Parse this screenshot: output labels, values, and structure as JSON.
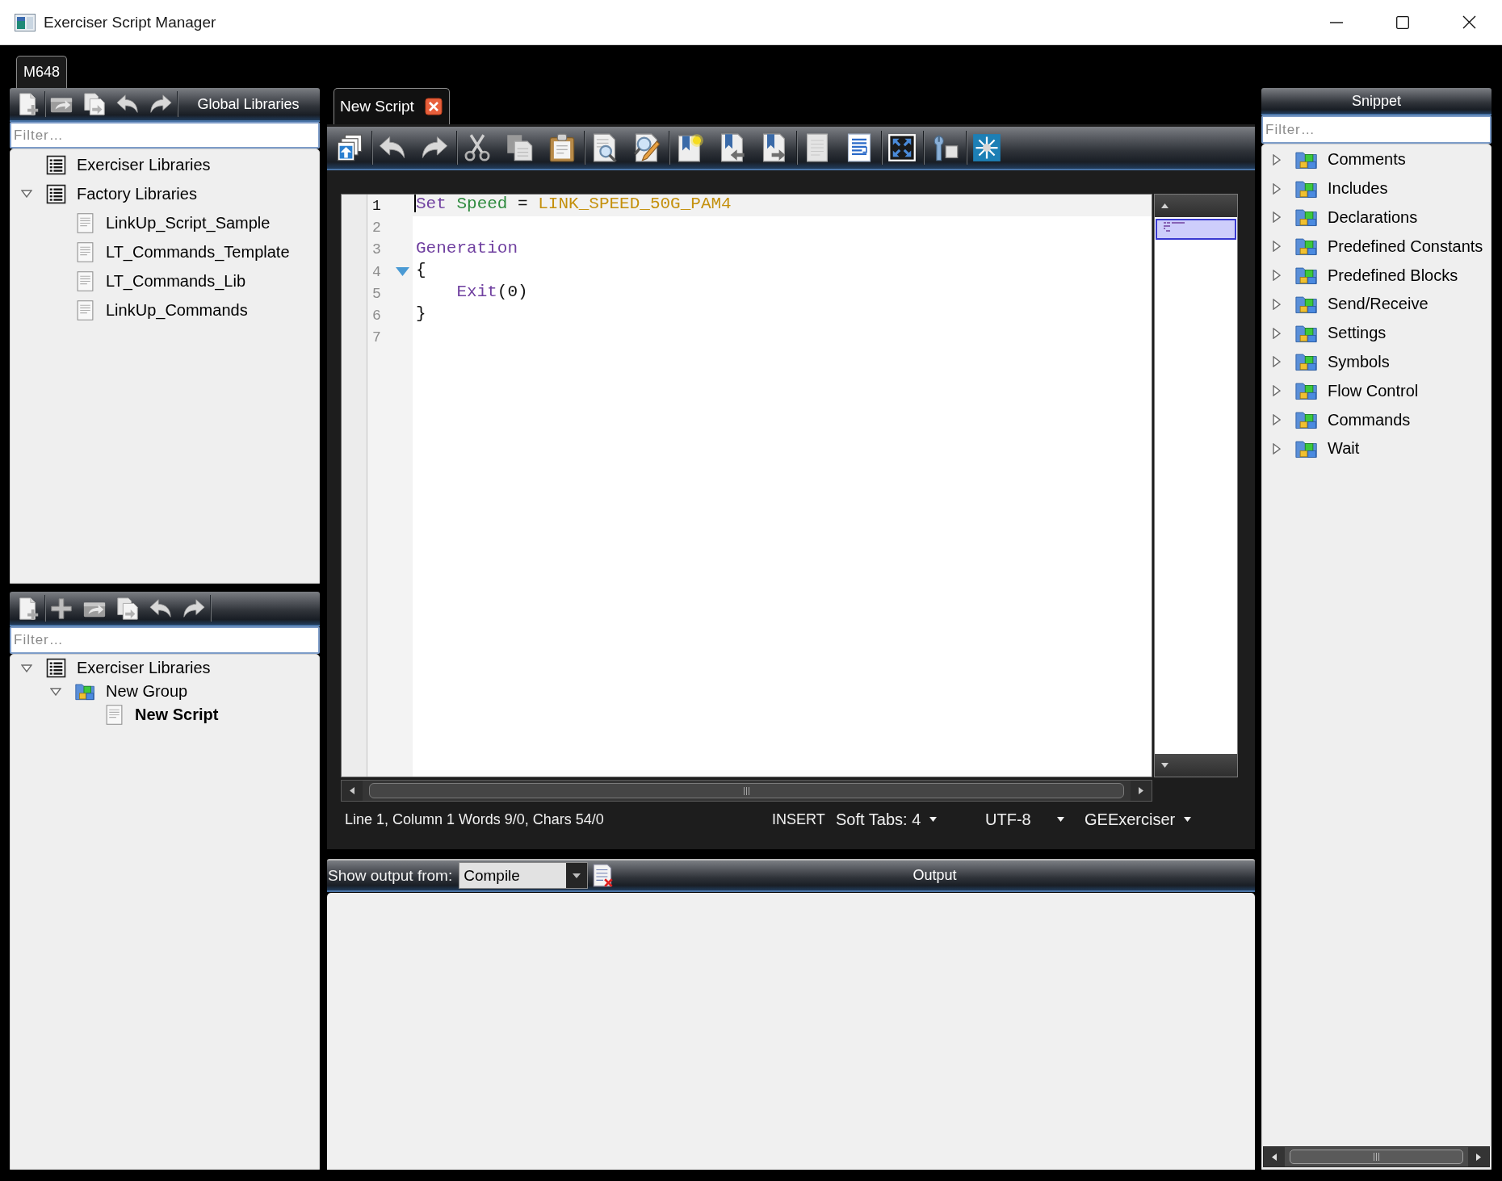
{
  "window": {
    "title": "Exerciser Script Manager"
  },
  "device_tabs": [
    {
      "label": "M648",
      "selected": true
    }
  ],
  "global_libraries": {
    "toolbar": [
      {
        "kind": "new"
      },
      {
        "kind": "separator"
      },
      {
        "kind": "export"
      },
      {
        "kind": "copy-out"
      },
      {
        "kind": "undo"
      },
      {
        "kind": "redo"
      },
      {
        "kind": "separator"
      }
    ],
    "title": "Global Libraries",
    "filter": {
      "placeholder": "Filter…"
    },
    "tree": [
      {
        "label": "Exerciser Libraries",
        "kind": "library"
      },
      {
        "label": "Factory Libraries",
        "kind": "library",
        "expanded": true,
        "children": [
          {
            "label": "LinkUp_Script_Sample",
            "kind": "script"
          },
          {
            "label": "LT_Commands_Template",
            "kind": "script"
          },
          {
            "label": "LT_Commands_Lib",
            "kind": "script"
          },
          {
            "label": "LinkUp_Commands",
            "kind": "script"
          }
        ]
      }
    ]
  },
  "workspace": {
    "toolbar": [
      {
        "kind": "new"
      },
      {
        "kind": "separator"
      },
      {
        "kind": "add"
      },
      {
        "kind": "export"
      },
      {
        "kind": "copy-out"
      },
      {
        "kind": "undo"
      },
      {
        "kind": "redo"
      },
      {
        "kind": "separator"
      }
    ],
    "filter": {
      "placeholder": "Filter…"
    },
    "tree": [
      {
        "label": "Exerciser Libraries",
        "kind": "library",
        "expanded": true,
        "current": false,
        "children": [
          {
            "label": "New Group",
            "kind": "group",
            "expanded": true,
            "current": false,
            "children": [
              {
                "label": "New Script",
                "kind": "script",
                "current": true
              }
            ]
          }
        ]
      }
    ]
  },
  "editor": {
    "tabs": [
      {
        "label": "New Script",
        "selected": true
      }
    ],
    "toolbar": [
      {
        "kind": "windows"
      },
      {
        "kind": "separator"
      },
      {
        "kind": "undo"
      },
      {
        "kind": "redo"
      },
      {
        "kind": "separator"
      },
      {
        "kind": "cut"
      },
      {
        "kind": "copy"
      },
      {
        "kind": "paste"
      },
      {
        "kind": "separator"
      },
      {
        "kind": "find"
      },
      {
        "kind": "replace"
      },
      {
        "kind": "separator"
      },
      {
        "kind": "bookmark"
      },
      {
        "kind": "bookmark-prev"
      },
      {
        "kind": "bookmark-next"
      },
      {
        "kind": "separator"
      },
      {
        "kind": "document"
      },
      {
        "kind": "wrap"
      },
      {
        "kind": "separator"
      },
      {
        "kind": "fullscreen"
      },
      {
        "kind": "separator"
      },
      {
        "kind": "tools"
      },
      {
        "kind": "separator"
      },
      {
        "kind": "network"
      }
    ],
    "lines": [
      {
        "number": "1",
        "current": true,
        "fold_marker": false,
        "tokens": [
          {
            "text": "Set ",
            "kind": "keyword"
          },
          {
            "text": "Speed ",
            "kind": "identifier"
          },
          {
            "text": "= ",
            "kind": "plain"
          },
          {
            "text": "LINK_SPEED_50G_PAM4",
            "kind": "constant"
          }
        ]
      },
      {
        "number": "2",
        "current": false,
        "fold_marker": false
      },
      {
        "number": "3",
        "current": false,
        "fold_marker": false,
        "tokens": [
          {
            "text": "Generation",
            "kind": "keyword"
          }
        ]
      },
      {
        "number": "4",
        "current": false,
        "fold_marker": true,
        "tokens": [
          {
            "text": "{",
            "kind": "plain"
          }
        ]
      },
      {
        "number": "5",
        "current": false,
        "fold_marker": false,
        "tokens": [
          {
            "text": "    Exit",
            "kind": "keyword"
          },
          {
            "text": "(0)",
            "kind": "plain"
          }
        ]
      },
      {
        "number": "6",
        "current": false,
        "fold_marker": false,
        "tokens": [
          {
            "text": "}",
            "kind": "plain"
          }
        ]
      },
      {
        "number": "7",
        "current": false,
        "fold_marker": false
      }
    ],
    "status_bar": {
      "position": "Line 1, Column 1 Words 9/0, Chars 54/0",
      "mode": "INSERT",
      "tab_setting": "Soft Tabs: 4",
      "encoding": "UTF-8",
      "language": "GEExerciser"
    }
  },
  "output": {
    "source_label": "Show output from:",
    "source": "Compile",
    "title": "Output"
  },
  "snippets": {
    "title": "Snippet",
    "filter": {
      "placeholder": "Filter…"
    },
    "tree": [
      {
        "label": "Comments",
        "kind": "group",
        "expanded": false
      },
      {
        "label": "Includes",
        "kind": "group",
        "expanded": false
      },
      {
        "label": "Declarations",
        "kind": "group",
        "expanded": false
      },
      {
        "label": "Predefined Constants",
        "kind": "group",
        "expanded": false
      },
      {
        "label": "Predefined Blocks",
        "kind": "group",
        "expanded": false
      },
      {
        "label": "Send/Receive",
        "kind": "group",
        "expanded": false
      },
      {
        "label": "Settings",
        "kind": "group",
        "expanded": false
      },
      {
        "label": "Symbols",
        "kind": "group",
        "expanded": false
      },
      {
        "label": "Flow Control",
        "kind": "group",
        "expanded": false
      },
      {
        "label": "Commands",
        "kind": "group",
        "expanded": false
      },
      {
        "label": "Wait",
        "kind": "group",
        "expanded": false
      }
    ]
  }
}
